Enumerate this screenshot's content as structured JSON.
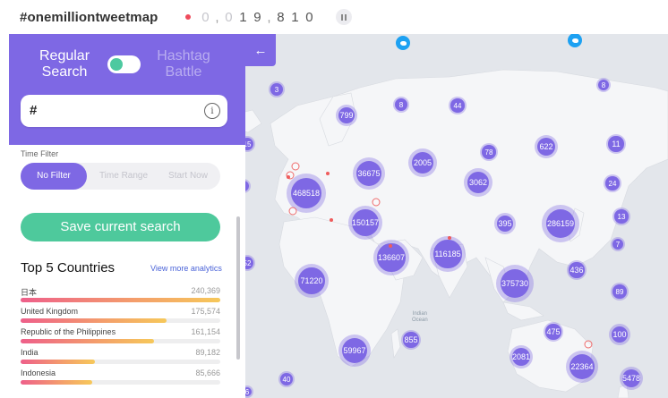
{
  "app": {
    "hashtag": "#onemilliontweetmap",
    "counter_digits": [
      "0",
      ",",
      "0",
      "1",
      "9",
      ",",
      "8",
      "1",
      "0"
    ],
    "live_color": "#ef4b5c"
  },
  "colors": {
    "accent": "#7e68e4",
    "save": "#4ec99c",
    "twitter": "#1da1f2",
    "map_bg": "#e3e6eb"
  },
  "panel": {
    "collapse_icon": "arrow-left-icon",
    "mode_regular": "Regular\nSearch",
    "mode_hashtag": "Hashtag\nBattle",
    "toggle_on": "regular",
    "search": {
      "value": "#",
      "info_icon": "info-icon"
    },
    "time_filter_label": "Time Filter",
    "time_filter_options": [
      "No Filter",
      "Time Range",
      "Start Now"
    ],
    "time_filter_selected": "No Filter",
    "save_label": "Save current search",
    "top_title": "Top 5 Countries",
    "more_label": "View more analytics",
    "countries": [
      {
        "name": "日本",
        "value": "240,369",
        "ratio": 1.0
      },
      {
        "name": "United Kingdom",
        "value": "175,574",
        "ratio": 0.73
      },
      {
        "name": "Republic of the Philippines",
        "value": "161,154",
        "ratio": 0.67
      },
      {
        "name": "India",
        "value": "89,182",
        "ratio": 0.37
      },
      {
        "name": "Indonesia",
        "value": "85,666",
        "ratio": 0.36
      }
    ]
  },
  "map": {
    "ocean_label": "Indian\nOcean",
    "clusters": [
      "3",
      "799",
      "8",
      "44",
      "15",
      "78",
      "622",
      "11",
      "36675",
      "2005",
      "3",
      "468518",
      "3062",
      "24",
      "150157",
      "395",
      "286159",
      "13",
      "7",
      "52",
      "136607",
      "116185",
      "71220",
      "436",
      "375730",
      "89",
      "855",
      "475",
      "100",
      "59967",
      "2081",
      "22364",
      "40",
      "5478",
      "6",
      "8"
    ]
  }
}
